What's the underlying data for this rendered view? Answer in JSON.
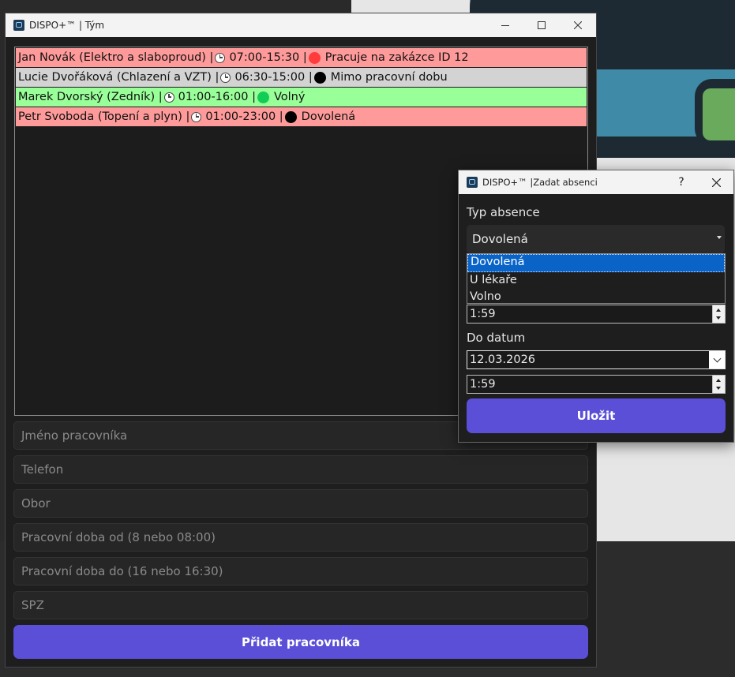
{
  "main_window": {
    "title": "DISPO+™ | Tým",
    "team": [
      {
        "name": "Jan Novák (Elektro a slaboproud) |",
        "hours": "07:00-15:30 |",
        "status": "Pracuje na zakázce ID 12",
        "row_color": "#ff9a9a",
        "dot_color": "#ff3b3b"
      },
      {
        "name": "Lucie Dvořáková (Chlazení a VZT) |",
        "hours": "06:30-15:00 |",
        "status": "Mimo pracovní dobu",
        "row_color": "#d3d3d3",
        "dot_color": "#000000"
      },
      {
        "name": "Marek Dvorský (Zedník) |",
        "hours": "01:00-16:00 |",
        "status": "Volný",
        "row_color": "#99ff99",
        "dot_color": "#11cc55"
      },
      {
        "name": "Petr Svoboda (Topení a plyn) |",
        "hours": "01:00-23:00 |",
        "status": "Dovolená",
        "row_color": "#ff9a9a",
        "dot_color": "#000000"
      }
    ],
    "fields": {
      "name_placeholder": "Jméno pracovníka",
      "phone_placeholder": "Telefon",
      "field_placeholder": "Obor",
      "hours_from_placeholder": "Pracovní doba od (8 nebo 08:00)",
      "hours_to_placeholder": "Pracovní doba do (16 nebo 16:30)",
      "plate_placeholder": "SPZ"
    },
    "add_button": "Přidat pracovníka",
    "accent_color": "#5a4fd6"
  },
  "dialog": {
    "title": "DISPO+™ |Zadat absenci",
    "help_label": "?",
    "absence_type_label": "Typ absence",
    "absence_type_value": "Dovolená",
    "absence_options": [
      "Dovolená",
      "U lékaře",
      "Volno"
    ],
    "from_time": "1:59",
    "to_date_label": "Do datum",
    "to_date": "12.03.2026",
    "to_time": "1:59",
    "save_button": "Uložit"
  }
}
